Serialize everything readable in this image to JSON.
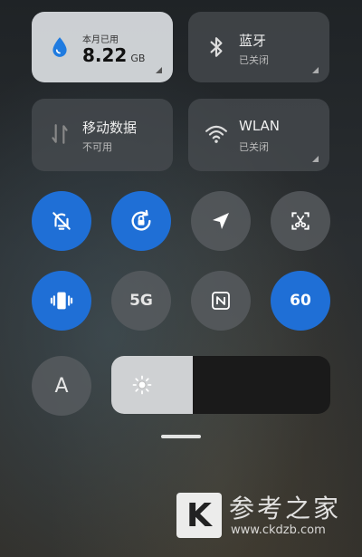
{
  "tiles": {
    "data_usage": {
      "label": "本月已用",
      "value": "8.22",
      "unit": "GB",
      "icon": "water-drop-icon"
    },
    "bluetooth": {
      "title": "蓝牙",
      "status": "已关闭",
      "icon": "bluetooth-icon"
    },
    "mobile_data": {
      "title": "移动数据",
      "status": "不可用",
      "icon": "mobile-data-arrows-icon"
    },
    "wlan": {
      "title": "WLAN",
      "status": "已关闭",
      "icon": "wifi-icon"
    }
  },
  "toggles": {
    "mute": {
      "icon": "bell-off-icon",
      "state": "on"
    },
    "rotation_lock": {
      "icon": "rotation-lock-icon",
      "state": "on"
    },
    "location": {
      "icon": "location-arrow-icon",
      "state": "off"
    },
    "screenshot": {
      "icon": "scissors-screenshot-icon",
      "state": "off"
    },
    "vibrate": {
      "icon": "vibrate-icon",
      "state": "on"
    },
    "five_g": {
      "label": "5G",
      "state": "off"
    },
    "nfc": {
      "icon": "nfc-icon",
      "state": "off"
    },
    "refresh_rate": {
      "label": "60",
      "state": "on"
    },
    "auto_brightness": {
      "label": "A",
      "state": "off"
    }
  },
  "brightness": {
    "level_percent": 37,
    "icon": "sun-icon"
  },
  "colors": {
    "active": "#1f6fd6",
    "inactive": "#5a5e62",
    "light_tile": "#d6d9dc"
  },
  "watermark": {
    "logo_letter": "K",
    "title": "参考之家",
    "url": "www.ckdzb.com"
  }
}
